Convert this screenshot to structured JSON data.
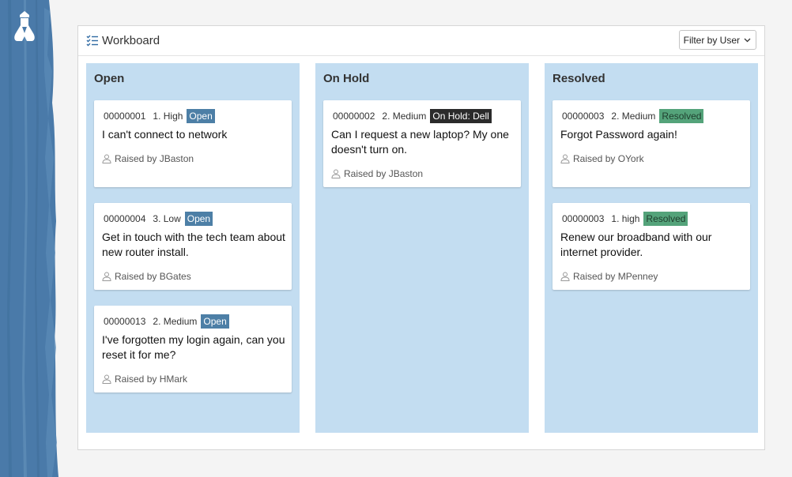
{
  "header": {
    "title": "Workboard",
    "filter_label": "Filter by User"
  },
  "columns": [
    {
      "title": "Open",
      "cards": [
        {
          "id": "00000001",
          "priority": "1. High",
          "status": "Open",
          "description": "I can't connect to network",
          "raised_by": "Raised by JBaston"
        },
        {
          "id": "00000004",
          "priority": "3. Low",
          "status": "Open",
          "description": "Get in touch with the tech team about new router install.",
          "raised_by": "Raised by BGates"
        },
        {
          "id": "00000013",
          "priority": "2. Medium",
          "status": "Open",
          "description": "I've forgotten my login again, can you reset it for me?",
          "raised_by": "Raised by HMark"
        }
      ]
    },
    {
      "title": "On Hold",
      "cards": [
        {
          "id": "00000002",
          "priority": "2. Medium",
          "status": "On Hold: Dell",
          "description": "Can I request a new laptop? My one doesn't turn on.",
          "raised_by": "Raised by JBaston"
        }
      ]
    },
    {
      "title": "Resolved",
      "cards": [
        {
          "id": "00000003",
          "priority": "2. Medium",
          "status": "Resolved",
          "description": "Forgot Password again!",
          "raised_by": "Raised by OYork"
        },
        {
          "id": "00000003",
          "priority": "1. high",
          "status": "Resolved",
          "description": "Renew our broadband with our internet provider.",
          "raised_by": "Raised by MPenney"
        }
      ]
    }
  ],
  "colors": {
    "brush": "#4a7aa9",
    "column_bg": "#c3ddf1",
    "badge_open": "#4d7fa6",
    "badge_hold": "#2b2b2b",
    "badge_resolved": "#54a37a"
  },
  "icons": {
    "logo": "lighthouse-logo-icon",
    "title": "checklist-icon",
    "filter": "chevron-down-icon",
    "raised": "user-icon"
  }
}
